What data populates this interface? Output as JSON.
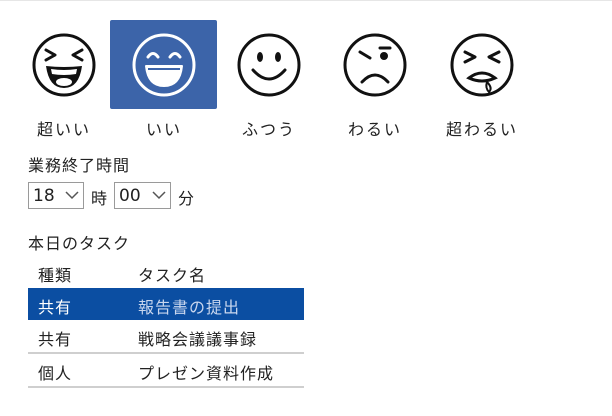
{
  "moods": [
    {
      "label": "超いい",
      "icon": "laughing-face-icon",
      "selected": false
    },
    {
      "label": "いい",
      "icon": "grinning-face-icon",
      "selected": true
    },
    {
      "label": "ふつう",
      "icon": "smiling-face-icon",
      "selected": false
    },
    {
      "label": "わるい",
      "icon": "frowning-face-icon",
      "selected": false
    },
    {
      "label": "超わるい",
      "icon": "crying-face-icon",
      "selected": false
    }
  ],
  "colors": {
    "selected_mood_bg": "#3c64a9",
    "selected_row_bg": "#0b4ea2"
  },
  "end_time": {
    "title": "業務終了時間",
    "hour": "18",
    "hour_unit": "時",
    "minute": "00",
    "minute_unit": "分"
  },
  "tasks": {
    "title": "本日のタスク",
    "columns": [
      "種類",
      "タスク名"
    ],
    "rows": [
      {
        "type": "共有",
        "name": "報告書の提出",
        "selected": true
      },
      {
        "type": "共有",
        "name": "戦略会議議事録",
        "selected": false
      },
      {
        "type": "個人",
        "name": "プレゼン資料作成",
        "selected": false
      }
    ]
  }
}
